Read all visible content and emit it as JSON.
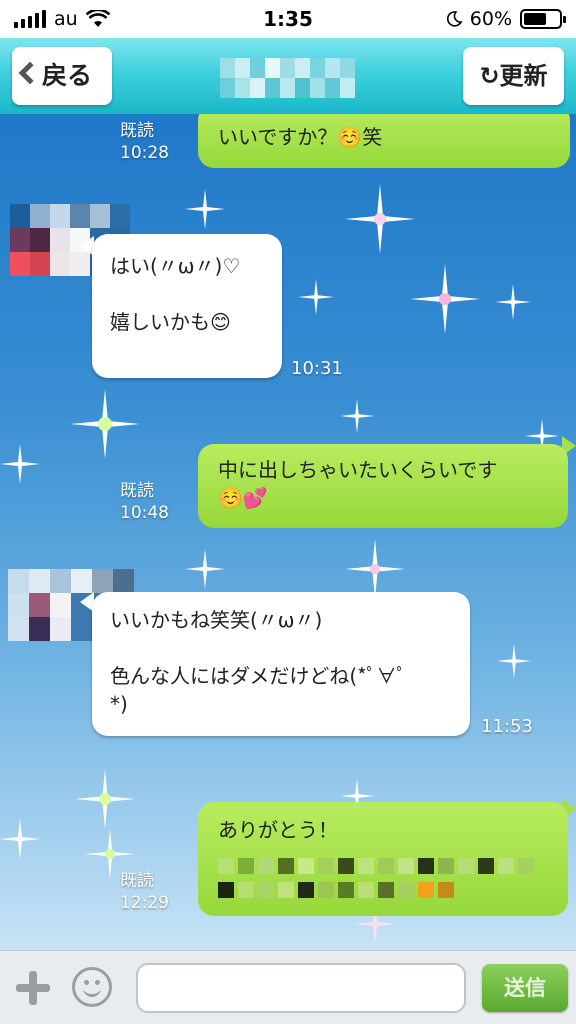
{
  "statusbar": {
    "carrier": "au",
    "time": "1:35",
    "battery": "60%"
  },
  "header": {
    "back_label": "戻る",
    "refresh_label": "更新"
  },
  "messages": [
    {
      "side": "me",
      "read": "既読",
      "time": "10:28",
      "text": "いいですか？☺️笑"
    },
    {
      "side": "them",
      "time": "10:31",
      "line1": "はい(〃ω〃)♡",
      "line2": "嬉しいかも😊"
    },
    {
      "side": "me",
      "read": "既読",
      "time": "10:48",
      "line1": "中に出しちゃいたいくらいです",
      "line2": "☺️💕"
    },
    {
      "side": "them",
      "time": "11:53",
      "line1": "いいかもね笑笑(〃ω〃)",
      "line2": "色んな人にはダメだけどね(*ﾟ∀ﾟ",
      "line3": "*)"
    },
    {
      "side": "me",
      "read": "既読",
      "time": "12:29",
      "text": "ありがとう！"
    }
  ],
  "input": {
    "placeholder": ""
  },
  "send_label": "送信",
  "colors": {
    "header": "#3fd0de",
    "my_bubble": "#a5e04a",
    "their_bubble": "#ffffff",
    "send": "#6cb842"
  }
}
